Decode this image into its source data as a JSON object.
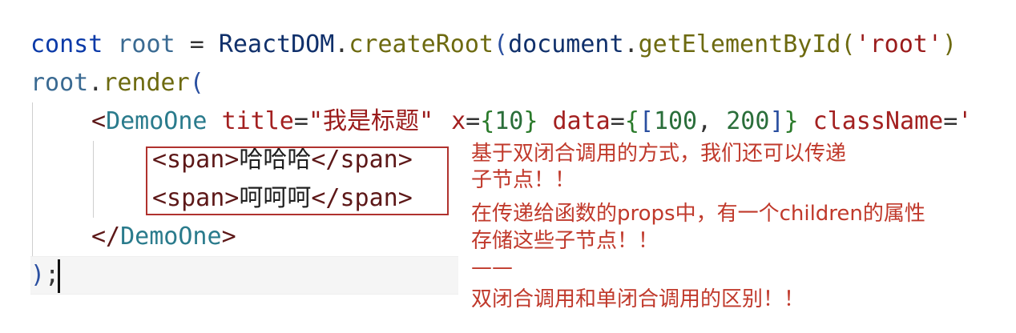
{
  "code": {
    "line1": {
      "kw": "const",
      "var": "root",
      "eq": "=",
      "obj": "ReactDOM",
      "dot1": ".",
      "fn": "createRoot",
      "paren_open": "(",
      "doc": "document",
      "dot2": ".",
      "fn2": "getElementById",
      "paren2": "(",
      "str": "'root'",
      "paren2_close": ")"
    },
    "line2": {
      "var": "root",
      "dot": ".",
      "fn": "render",
      "paren": "("
    },
    "line3": {
      "lt": "<",
      "component": "DemoOne",
      "attr1": "title",
      "eq1": "=",
      "val1": "\"我是标题\"",
      "attr2": "x",
      "eq2": "=",
      "brace2_open": "{",
      "val2": "10",
      "brace2_close": "}",
      "attr3": "data",
      "eq3": "=",
      "brace3_open": "{",
      "bracket_open": "[",
      "val3a": "100",
      "comma": ",",
      "val3b": "200",
      "bracket_close": "]",
      "brace3_close": "}",
      "attr4": "className",
      "eq4": "=",
      "val4": "'"
    },
    "line4": {
      "open_tag": "<span>",
      "text": "哈哈哈",
      "close_tag": "</span>"
    },
    "line5": {
      "open_tag": "<span>",
      "text": "呵呵呵",
      "close_tag": "</span>"
    },
    "line6": {
      "lt": "</",
      "component": "DemoOne",
      "gt": ">"
    },
    "line7": {
      "paren": ")",
      "semi": ";"
    }
  },
  "annotation": {
    "lines": [
      "基于双闭合调用的方式，我们还可以传递",
      "子节点！！",
      "在传递给函数的props中，有一个children的属性",
      "存储这些子节点！！",
      "——",
      "双闭合调用和单闭合调用的区别！！"
    ]
  },
  "colors": {
    "keyword": "#0b3aa8",
    "string": "#9a1b1b",
    "annotation": "#c0392b",
    "highlight_border": "#b0322e"
  }
}
